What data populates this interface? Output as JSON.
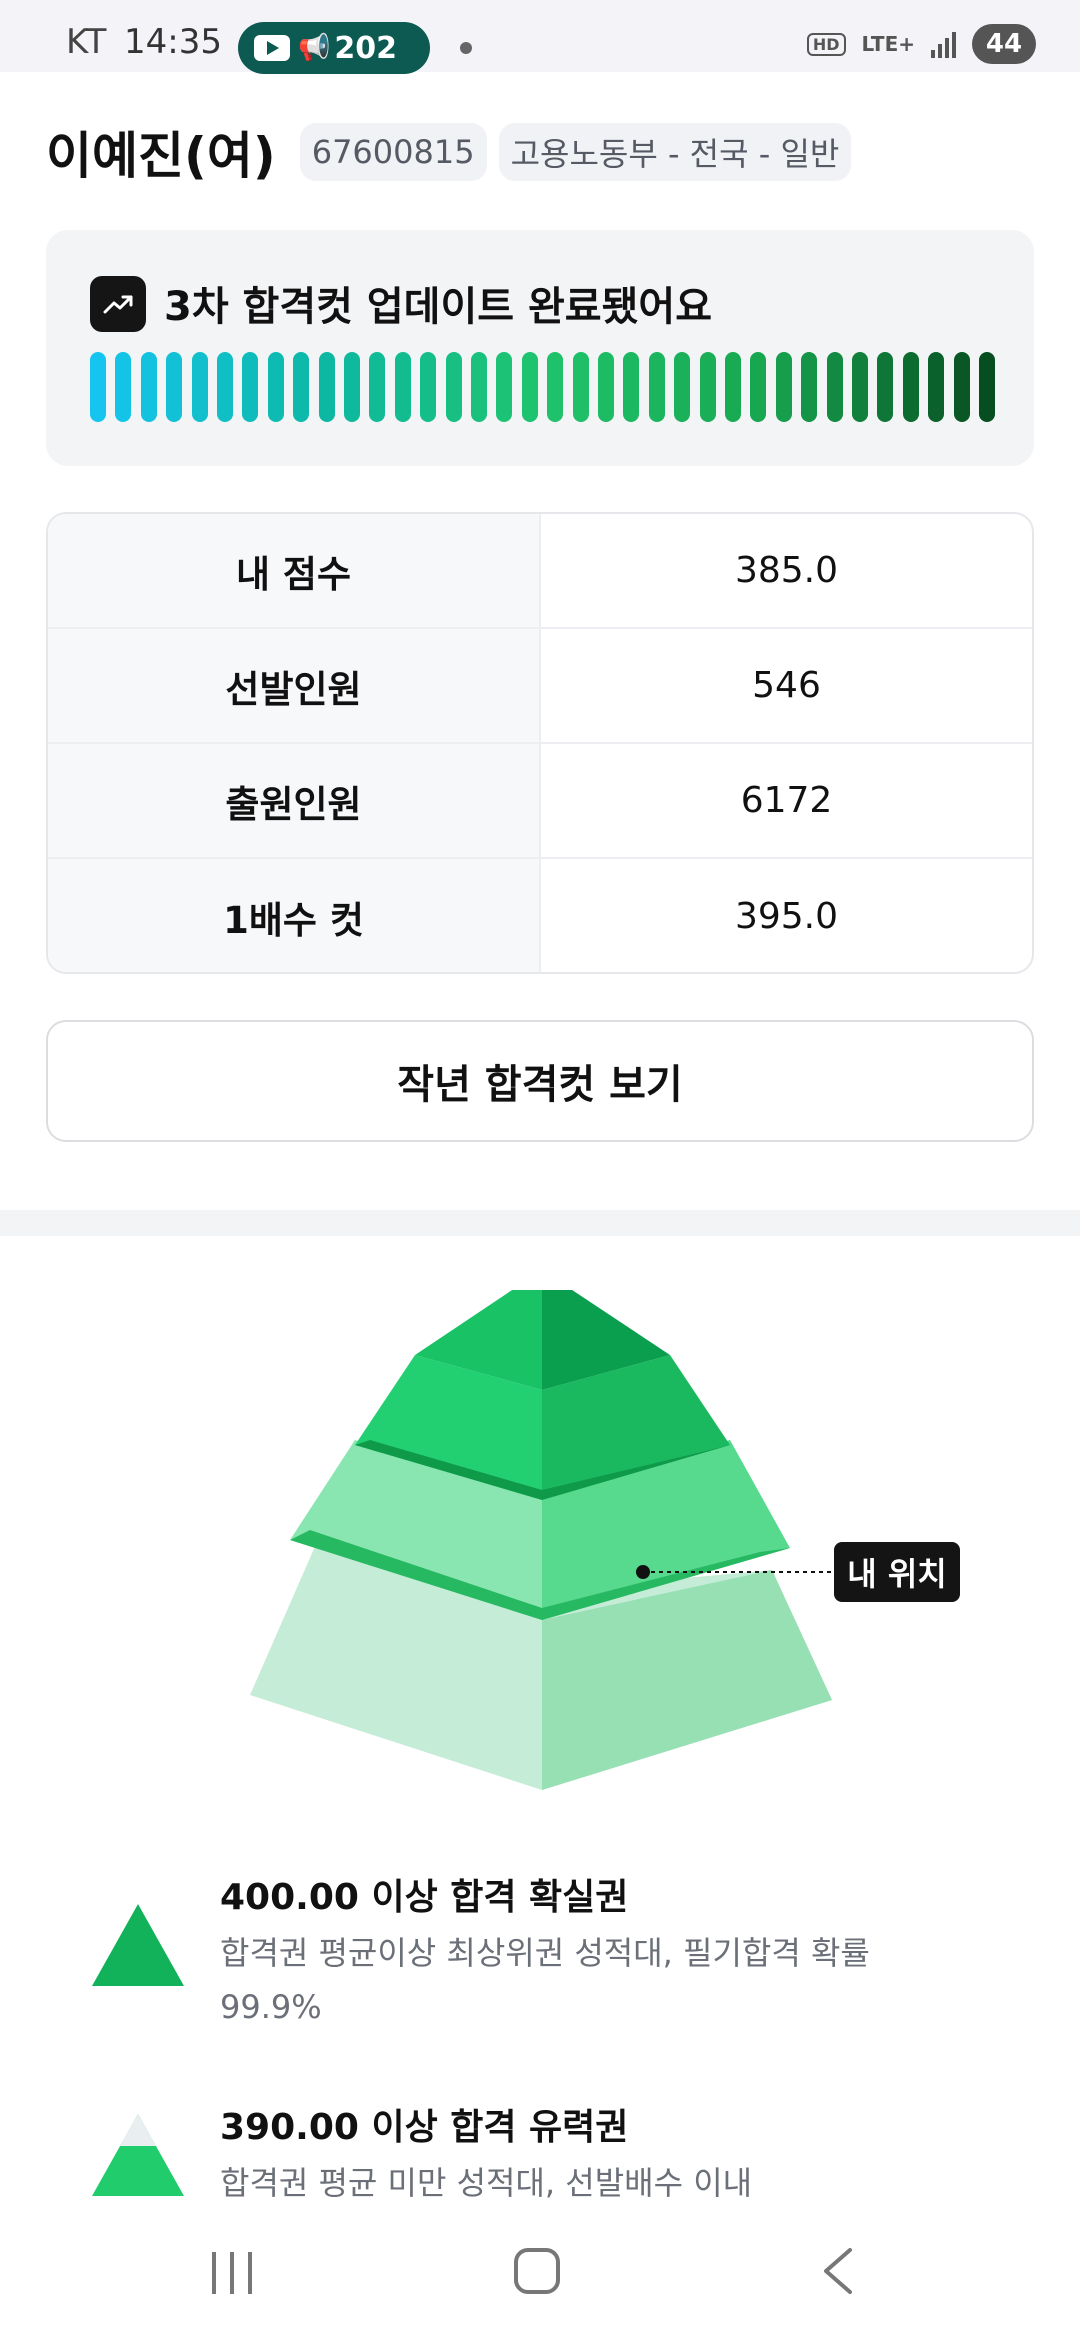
{
  "status_bar": {
    "carrier": "KT",
    "time": "14:35",
    "media_text": "202",
    "hd": "HD",
    "network": "LTE+",
    "battery": "44"
  },
  "header": {
    "name": "이예진(여)",
    "id": "67600815",
    "category": "고용노동부 - 전국 - 일반"
  },
  "update": {
    "title": "3차 합격컷 업데이트 완료됐어요",
    "icon": "trending-up-icon"
  },
  "stats": [
    {
      "label": "내 점수",
      "value": "385.0"
    },
    {
      "label": "선발인원",
      "value": "546"
    },
    {
      "label": "출원인원",
      "value": "6172"
    },
    {
      "label": "1배수 컷",
      "value": "395.0"
    }
  ],
  "lastyear_button": "작년 합격컷 보기",
  "pyramid": {
    "my_position_label": "내 위치"
  },
  "legend": [
    {
      "title": "400.00 이상 합격 확실권",
      "desc": "합격권 평균이상 최상위권 성적대, 필기합격 확률 99.9%"
    },
    {
      "title": "390.00 이상 합격 유력권",
      "desc": "합격권 평균 미만 성적대, 선발배수 이내"
    }
  ],
  "colors": {
    "accent_green": "#1fc46c",
    "dark_green": "#0a9e4f",
    "bar_start": "#15c5f0",
    "bar_end": "#064d20"
  }
}
